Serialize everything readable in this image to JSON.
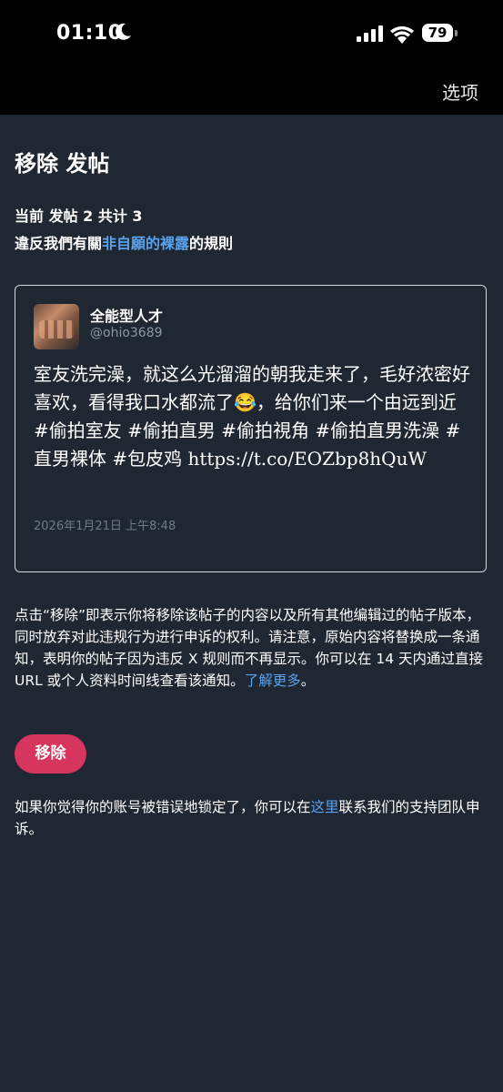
{
  "status_bar": {
    "time": "01:10",
    "battery": "79",
    "icons": [
      "moon-icon",
      "signal-icon",
      "wifi-icon",
      "battery-icon"
    ]
  },
  "nav": {
    "options_label": "选项"
  },
  "page": {
    "title": "移除 发帖",
    "post_count": "当前 发帖 2 共计 3",
    "rule_prefix": "違反我們有關",
    "rule_link": "非自願的裸露",
    "rule_suffix": "的規則"
  },
  "post": {
    "author_name": "全能型人才",
    "author_handle": "@ohio3689",
    "text": "室友洗完澡，就这么光溜溜的朝我走来了，毛好浓密好喜欢，看得我口水都流了😂，给你们来一个由远到近 #偷拍室友 #偷拍直男 #偷拍視角 #偷拍直男洗澡 #直男裸体 #包皮鸡 https://t.co/EOZbp8hQuW",
    "date": "2026年1月21日 上午8:48"
  },
  "notice": {
    "text": "点击“移除”即表示你将移除该帖子的内容以及所有其他编辑过的帖子版本，同时放弃对此违规行为进行申诉的权利。请注意，原始内容将替换成一条通知，表明你的帖子因为违反 X 规则而不再显示。你可以在 14 天内通过直接 URL 或个人资料时间线查看该通知。",
    "learn_more": "了解更多",
    "end": "。"
  },
  "remove_button": "移除",
  "appeal": {
    "prefix": "如果你觉得你的账号被错误地锁定了，你可以在",
    "link": "这里",
    "suffix": "联系我们的支持团队申诉。"
  },
  "colors": {
    "background": "#1e2732",
    "link": "#5aa2ee",
    "button": "#d6355e",
    "muted": "#8b98a5"
  }
}
